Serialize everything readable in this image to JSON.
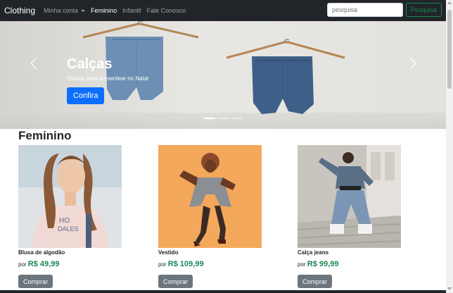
{
  "navbar": {
    "brand": "Clothing",
    "links": [
      {
        "label": "Minha conta",
        "dropdown": true,
        "active": false
      },
      {
        "label": "Feminino",
        "active": true
      },
      {
        "label": "Infantil",
        "active": false
      },
      {
        "label": "Fale Conosco",
        "active": false
      }
    ],
    "search_placeholder": "pesquisa",
    "search_button": "Pesquisa"
  },
  "carousel": {
    "title": "Calças",
    "subtitle": "Otimas para presentear no Natal",
    "button": "Confira",
    "slides": 3,
    "active_slide": 0
  },
  "section": {
    "title": "Feminino"
  },
  "products": [
    {
      "name": "Blusa de algodão",
      "price_prefix": "por",
      "price": "R$ 49,99",
      "button": "Comprar"
    },
    {
      "name": "Vestido",
      "price_prefix": "por",
      "price": "R$ 109,99",
      "button": "Comprar"
    },
    {
      "name": "Calça jeans",
      "price_prefix": "por",
      "price": "R$ 99,99",
      "button": "Comprar"
    }
  ],
  "colors": {
    "navbar_bg": "#212529",
    "primary": "#0d6efd",
    "success": "#198754",
    "secondary": "#6c757d"
  },
  "icons": {
    "carousel_prev": "chevron-left-icon",
    "carousel_next": "chevron-right-icon",
    "dropdown": "caret-down-icon"
  }
}
